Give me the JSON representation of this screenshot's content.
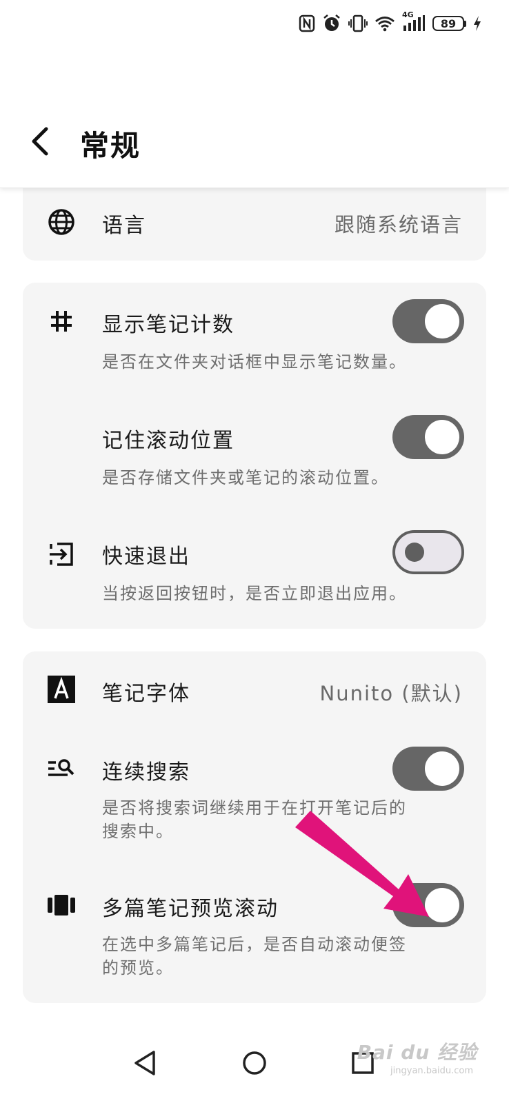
{
  "status": {
    "battery": "89",
    "network": "4G"
  },
  "header": {
    "title": "常规"
  },
  "card1": {
    "language": {
      "title": "语言",
      "value": "跟随系统语言",
      "icon": "globe-icon"
    }
  },
  "card2": {
    "show_count": {
      "title": "显示笔记计数",
      "desc": "是否在文件夹对话框中显示笔记数量。",
      "on": true,
      "icon": "hash-icon"
    },
    "remember_scroll": {
      "title": "记住滚动位置",
      "desc": "是否存储文件夹或笔记的滚动位置。",
      "on": true
    },
    "quick_exit": {
      "title": "快速退出",
      "desc": "当按返回按钮时，是否立即退出应用。",
      "on": false,
      "icon": "exit-icon"
    }
  },
  "card3": {
    "note_font": {
      "title": "笔记字体",
      "value": "Nunito (默认)",
      "icon": "font-icon"
    },
    "continuous_search": {
      "title": "连续搜索",
      "desc_line1": "是否将搜索词继续用于在打开笔记后的",
      "desc_line2": "搜索中。",
      "on": true,
      "icon": "search-list-icon"
    },
    "multi_preview_scroll": {
      "title": "多篇笔记预览滚动",
      "desc_line1": "在选中多篇笔记后，是否自动滚动便签",
      "desc_line2": "的预览。",
      "on": true,
      "icon": "carousel-icon"
    }
  },
  "watermark": {
    "brand": "Bai du 经验",
    "url": "jingyan.baidu.com"
  },
  "colors": {
    "toggle_on": "#666666",
    "toggle_off_track": "#e9e6ec",
    "card_bg": "#f5f5f5",
    "annotation_arrow": "#e0137a"
  }
}
